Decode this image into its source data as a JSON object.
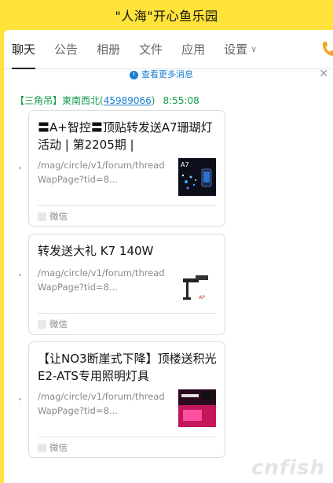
{
  "window": {
    "title": "\"人海\"开心鱼乐园"
  },
  "tabs": [
    {
      "label": "聊天",
      "active": true
    },
    {
      "label": "公告"
    },
    {
      "label": "相册"
    },
    {
      "label": "文件"
    },
    {
      "label": "应用"
    },
    {
      "label": "设置"
    }
  ],
  "chat": {
    "more_messages": "查看更多消息",
    "sender": {
      "prefix": "【三角吊】東南西北(",
      "uid": "45989066",
      "suffix": ")",
      "time": "8:55:08"
    },
    "cards": [
      {
        "title": "〓A+智控〓顶贴转发送A7珊瑚灯活动 | 第2205期 |",
        "url": "/mag/circle/v1/forum/threadWapPage?tid=8...",
        "source": "微信",
        "thumb_text": "A7"
      },
      {
        "title": "转发送大礼 K7 140W",
        "url": "/mag/circle/v1/forum/threadWapPage?tid=8...",
        "source": "微信",
        "thumb_text": ""
      },
      {
        "title": "【让NO3断崖式下降】顶楼送积光E2-ATS专用照明灯具",
        "url": "/mag/circle/v1/forum/threadWapPage?tid=8...",
        "source": "微信",
        "thumb_text": ""
      }
    ]
  },
  "watermark": "cnfish",
  "icons": {
    "phone": "phone-icon",
    "clock": "clock-icon",
    "close": "close-icon",
    "chevron": "chevron-down-icon",
    "wechat": "wechat-icon"
  },
  "colors": {
    "title_bar": "#ffe23a",
    "sender_green": "#169c4a",
    "link_blue": "#1b7fd1"
  }
}
